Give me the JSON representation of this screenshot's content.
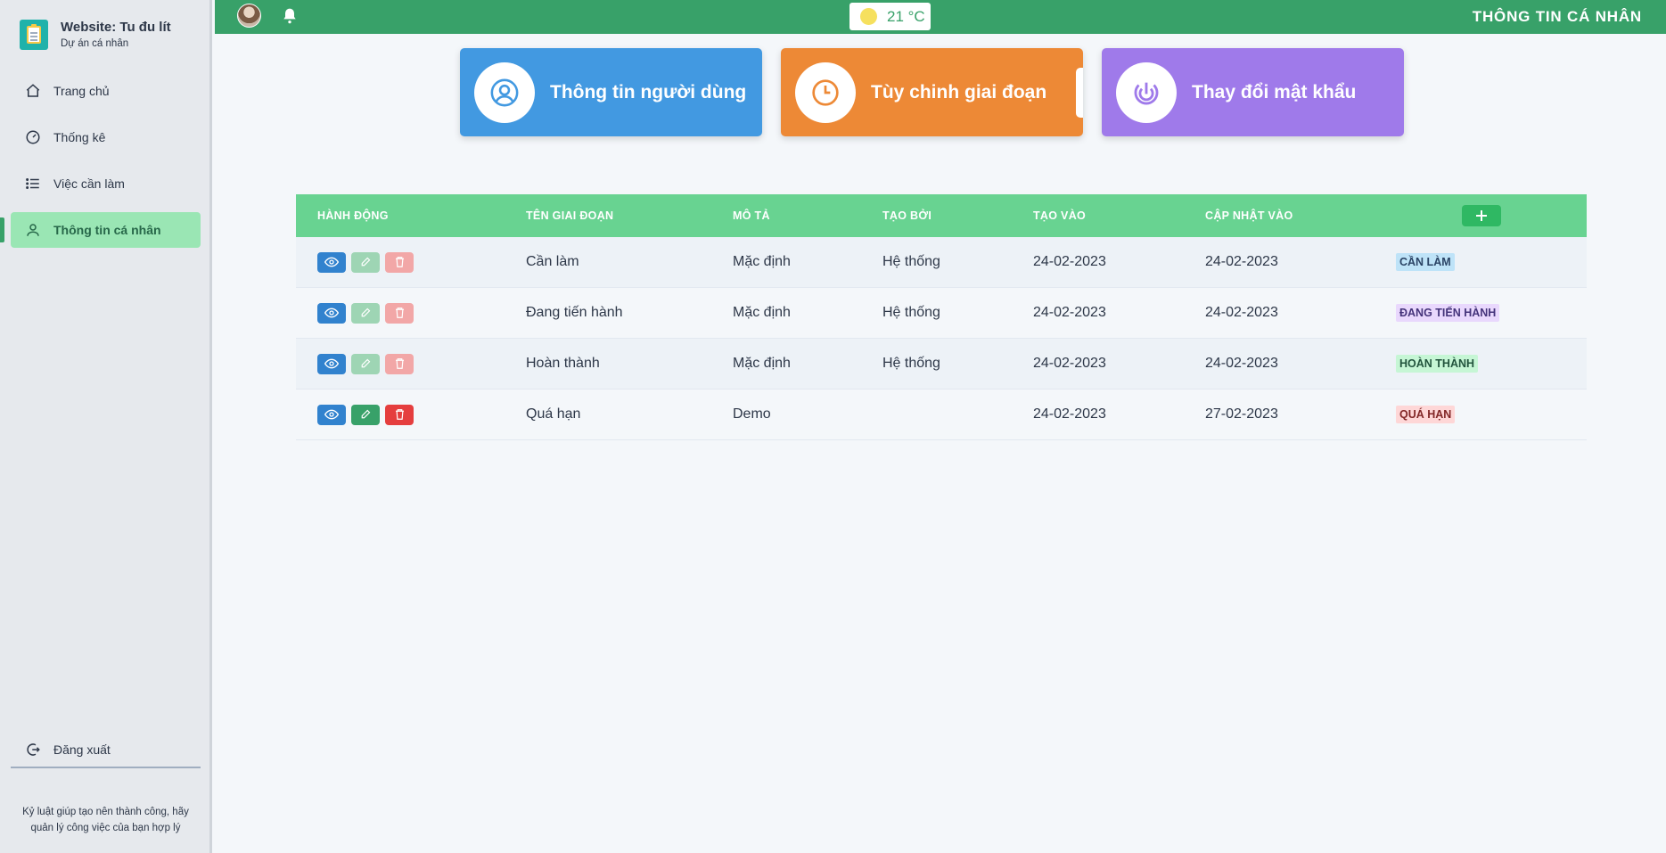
{
  "brand": {
    "title": "Website: Tu đu lít",
    "subtitle": "Dự án cá nhân"
  },
  "sidebar": {
    "items": [
      {
        "label": "Trang chủ",
        "icon": "home-icon"
      },
      {
        "label": "Thống kê",
        "icon": "gauge-icon"
      },
      {
        "label": "Việc cần làm",
        "icon": "list-icon"
      },
      {
        "label": "Thông tin cá nhân",
        "icon": "user-icon",
        "active": true
      }
    ],
    "logout": "Đăng xuất",
    "quote": "Kỷ luật giúp tạo nên thành công, hãy quản lý công việc của bạn hợp lý"
  },
  "topbar": {
    "temperature": "21 °C",
    "title": "THÔNG TIN CÁ NHÂN"
  },
  "cards": [
    {
      "label": "Thông tin người dùng",
      "color": "#4299e1",
      "icon": "user-circle-icon"
    },
    {
      "label": "Tùy chinh giai đoạn",
      "color": "#ed8936",
      "icon": "clock-icon"
    },
    {
      "label": "Thay đổi mật khẩu",
      "color": "#9f7aea",
      "icon": "fingerprint-icon"
    }
  ],
  "table": {
    "headers": [
      "HÀNH ĐỘNG",
      "TÊN GIAI ĐOẠN",
      "MÔ TẢ",
      "TẠO BỞI",
      "TẠO VÀO",
      "CẬP NHẬT VÀO"
    ],
    "rows": [
      {
        "name": "Cần làm",
        "desc": "Mặc định",
        "by": "Hệ thống",
        "created": "24-02-2023",
        "updated": "24-02-2023",
        "badge": "CẦN LÀM",
        "badge_color": "blue",
        "editable": false
      },
      {
        "name": "Đang tiến hành",
        "desc": "Mặc định",
        "by": "Hệ thống",
        "created": "24-02-2023",
        "updated": "24-02-2023",
        "badge": "ĐANG TIẾN HÀNH",
        "badge_color": "purple",
        "editable": false
      },
      {
        "name": "Hoàn thành",
        "desc": "Mặc định",
        "by": "Hệ thống",
        "created": "24-02-2023",
        "updated": "24-02-2023",
        "badge": "HOÀN THÀNH",
        "badge_color": "green",
        "editable": false
      },
      {
        "name": "Quá hạn",
        "desc": "Demo",
        "by": "",
        "created": "24-02-2023",
        "updated": "27-02-2023",
        "badge": "QUÁ HẠN",
        "badge_color": "red",
        "editable": true
      }
    ]
  },
  "colors": {
    "primary": "#38a169",
    "header_row": "#68d391"
  }
}
